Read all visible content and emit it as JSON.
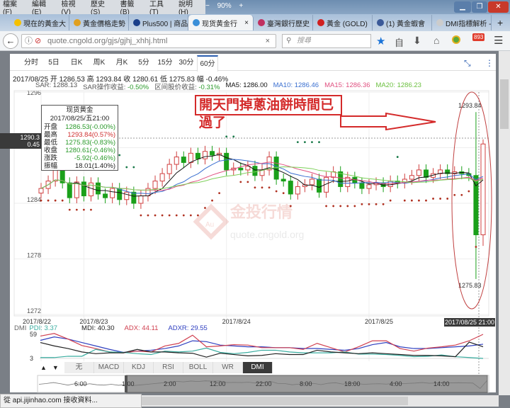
{
  "browser": {
    "menus": [
      "檔案 (F)",
      "編輯 (E)",
      "檢視 (V)",
      "歷史 (S)",
      "書籤 (B)",
      "工具 (T)",
      "說明 (H)"
    ],
    "zoom_minus": "−",
    "zoom_level": "90%",
    "zoom_plus": "+",
    "tabs": [
      {
        "label": "現在的黃金大",
        "color": "#f5c000"
      },
      {
        "label": "黃金價格走勢",
        "color": "#e0a020"
      },
      {
        "label": "Plus500 | 商品",
        "color": "#1a3f8a"
      },
      {
        "label": "现货黄金行",
        "color": "#3a8fd8",
        "active": true
      },
      {
        "label": "臺灣銀行歷史",
        "color": "#c03060"
      },
      {
        "label": "黃金 (GOLD)",
        "color": "#d02020"
      },
      {
        "label": "(1) 黃金蝦會",
        "color": "#3b5998"
      },
      {
        "label": "DMI指標解析 - 我",
        "color": "#cccccc"
      }
    ],
    "tab_close": "×",
    "new_tab": "+",
    "url": "quote.cngold.org/gjs/gjhj_xhhj.html",
    "url_clear": "×",
    "search_placeholder": "搜尋",
    "badge": "893",
    "status": "從 api.jijinhao.com 接收資料..."
  },
  "chart_tabs": [
    "分时",
    "5日",
    "日K",
    "周K",
    "月K",
    "5分",
    "15分",
    "30分",
    "60分"
  ],
  "active_tab": "60分",
  "quote": {
    "date": "2017/08/25",
    "open_label": "开",
    "open": "1286.53",
    "high_label": "高",
    "high": "1293.84",
    "close_label": "收",
    "close": "1280.61",
    "low_label": "低",
    "low": "1275.83",
    "chg_label": "幅",
    "chg": "-0.46%"
  },
  "indicators": {
    "sar": "SAR: 1288.13",
    "sar_gain_label": "SAR操作收益:",
    "sar_gain": "-0.50%",
    "range_gain_label": "区间股价收益:",
    "range_gain": "-0.31%",
    "ma5": "MA5: 1286.00",
    "ma10": "MA10: 1286.46",
    "ma15": "MA15: 1286.36",
    "ma20": "MA20: 1286.23"
  },
  "tooltip": {
    "title": "现货黄金",
    "time": "2017/08/25/五21:00",
    "rows": [
      {
        "k": "开盘",
        "v": "1286.53(-0.00%)",
        "c": "#2a9a2a"
      },
      {
        "k": "最高",
        "v": "1293.84(0.57%)",
        "c": "#d03030"
      },
      {
        "k": "最低",
        "v": "1275.83(-0.83%)",
        "c": "#2a9a2a"
      },
      {
        "k": "收盘",
        "v": "1280.61(-0.46%)",
        "c": "#2a9a2a"
      },
      {
        "k": "涨跌",
        "v": "-5.92(-0.46%)",
        "c": "#2a9a2a"
      },
      {
        "k": "振幅",
        "v": "18.01(1.40%)",
        "c": "#222"
      }
    ]
  },
  "crosshair": {
    "price": "1290.3",
    "pct": "0.45",
    "time": "2017/08/25 21:00"
  },
  "annotation": "開天門掉蔥油餅時間已過了",
  "watermark": {
    "name": "金投行情",
    "url": "quote.cngold.org",
    "logo": "Au"
  },
  "chart_data": {
    "type": "candlestick",
    "ylim": [
      1272,
      1296
    ],
    "yticks": [
      "1296",
      "1290",
      "1284",
      "1278",
      "1272"
    ],
    "ytick_values": [
      1296,
      1290,
      1284,
      1278,
      1272
    ],
    "dates": [
      "2017/8/22",
      "2017/8/23",
      "2017/8/24",
      "2017/8/25"
    ],
    "date_index": [
      0,
      6,
      26,
      46
    ],
    "close": [
      1285.6,
      1286.4,
      1287.6,
      1286.2,
      1284.6,
      1286.3,
      1284.8,
      1286.2,
      1285.0,
      1284.6,
      1285.6,
      1284.4,
      1285.2,
      1284.0,
      1284.8,
      1285.6,
      1286.4,
      1287.2,
      1288.2,
      1289.0,
      1288.4,
      1289.4,
      1288.8,
      1289.6,
      1289.2,
      1289.4,
      1287.6,
      1287.8,
      1287.6,
      1288.0,
      1287.0,
      1287.6,
      1289.0,
      1286.6,
      1286.4,
      1285.0,
      1285.8,
      1286.0,
      1286.6,
      1285.2,
      1286.8,
      1287.4,
      1285.8,
      1286.8,
      1286.2,
      1285.6,
      1286.0,
      1286.2,
      1285.8,
      1286.4,
      1286.2,
      1286.6,
      1287.0,
      1287.6,
      1286.8,
      1287.2,
      1287.6,
      1287.2,
      1287.4,
      1287.2,
      1287.0,
      1280.6,
      1290.4
    ],
    "last_high": 1293.84,
    "last_low": 1275.83,
    "max_label": "1293.84",
    "min_label": "1275.83",
    "colors": {
      "up": "#d04040",
      "down": "#1aa01a",
      "ma5": "#111111",
      "ma10": "#3a6fd0",
      "ma15": "#e05080",
      "ma20": "#7ed05a"
    }
  },
  "dmi": {
    "label": "DMI",
    "pdi": "PDI: 3.37",
    "mdi": "MDI: 40.30",
    "adx": "ADX: 44.11",
    "adxr": "ADXR: 29.55",
    "ticks": [
      "59",
      "3"
    ],
    "ylim": [
      3,
      59
    ],
    "pdi_values": [
      5,
      5,
      8,
      8,
      24,
      18,
      17,
      14,
      12,
      20,
      18,
      20,
      27,
      17,
      14,
      17,
      22,
      22,
      18,
      16,
      16,
      16,
      18,
      13,
      13,
      12,
      10,
      7,
      8,
      11,
      7,
      5,
      3
    ],
    "mdi_values": [
      40,
      32,
      26,
      18,
      14,
      16,
      16,
      24,
      18,
      18,
      16,
      15,
      6,
      15,
      12,
      9,
      10,
      14,
      12,
      12,
      22,
      18,
      16,
      14,
      16,
      14,
      12,
      10,
      10,
      9,
      7,
      41,
      30
    ],
    "adx_values": [
      55,
      61,
      48,
      33,
      26,
      18,
      16,
      20,
      18,
      32,
      38,
      57,
      30,
      32,
      35,
      34,
      28,
      28,
      28,
      24,
      38,
      28,
      18,
      30,
      44,
      44,
      26,
      20,
      27,
      30,
      34,
      44,
      59
    ],
    "adxr_values": [
      45,
      53,
      48,
      40,
      32,
      24,
      17,
      20,
      22,
      26,
      32,
      44,
      42,
      34,
      32,
      30,
      30,
      28,
      28,
      26,
      26,
      24,
      22,
      26,
      35,
      40,
      30,
      26,
      26,
      28,
      30,
      32,
      36
    ],
    "colors": {
      "pdi": "#3aada0",
      "mdi": "#222222",
      "adx": "#d04050",
      "adxr": "#3040c0"
    }
  },
  "indicator_buttons": [
    "无",
    "MACD",
    "KDJ",
    "RSI",
    "BOLL",
    "WR",
    "DMI"
  ],
  "active_indicator": "DMI",
  "navigator": {
    "labels": [
      "6:00",
      "1:00",
      "2:00",
      "12:00",
      "22:00",
      "8:00",
      "18:00",
      "4:00",
      "14:00"
    ]
  }
}
